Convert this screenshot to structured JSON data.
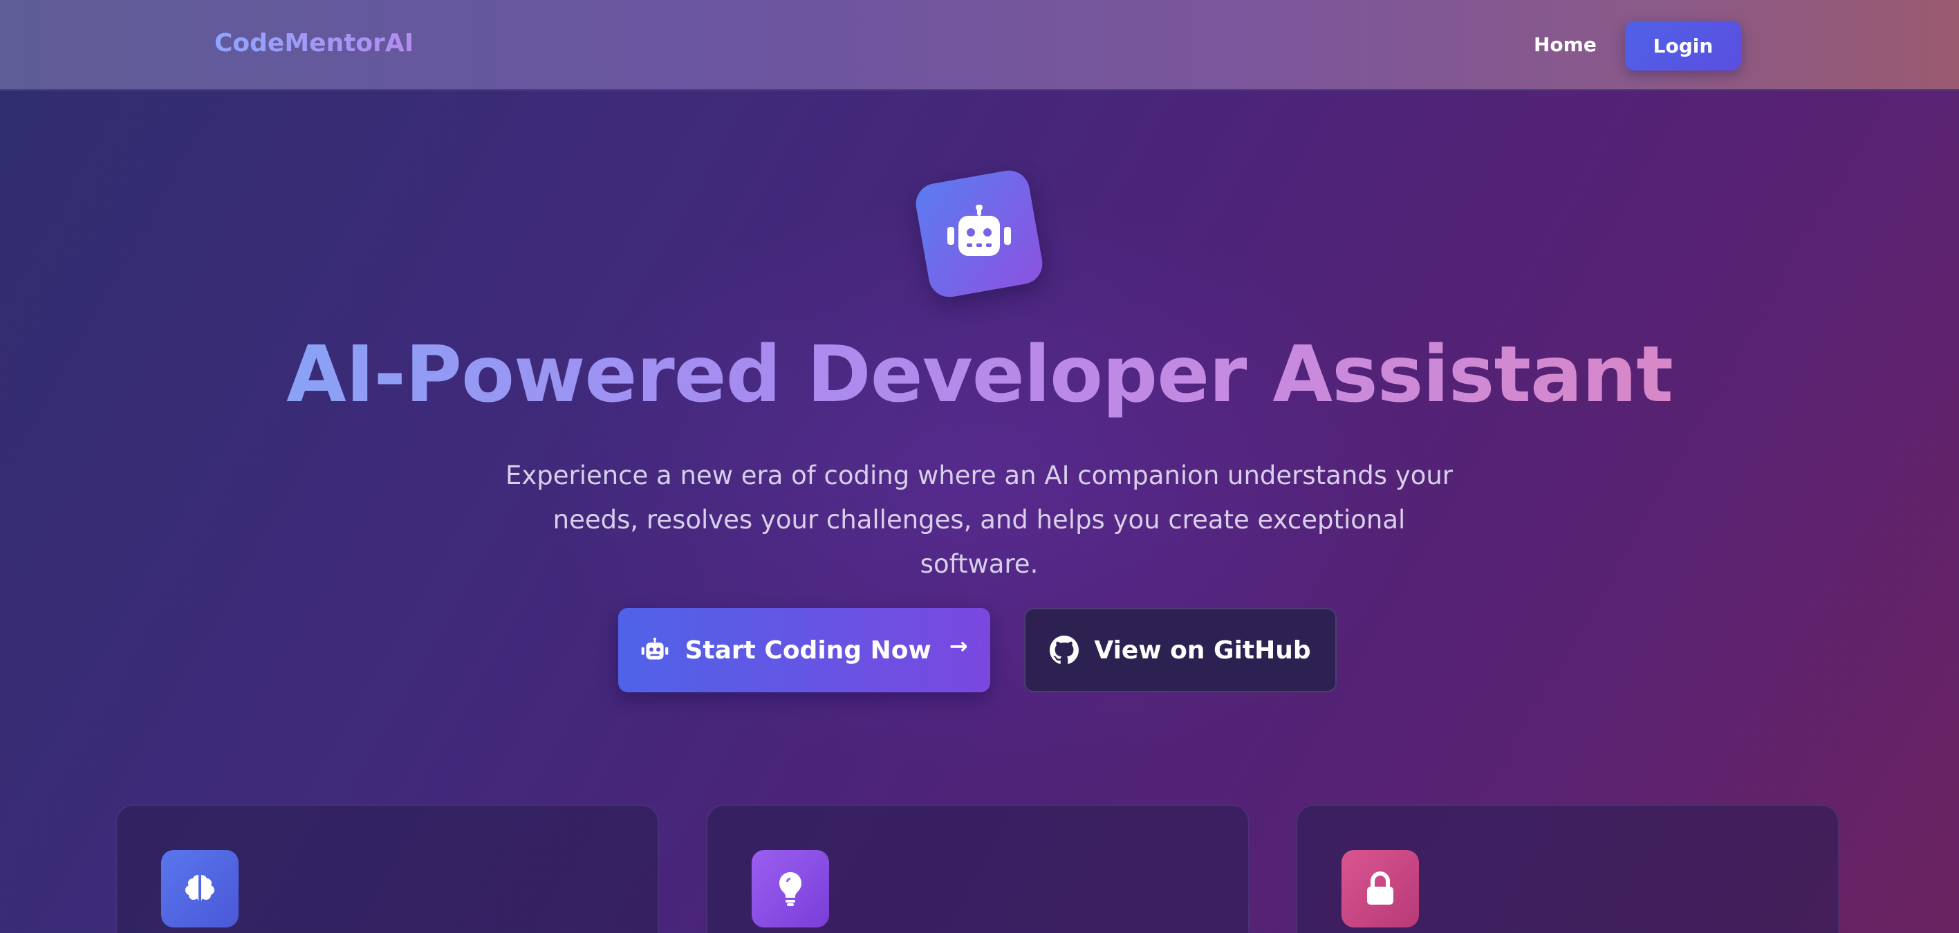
{
  "header": {
    "brand": "CodeMentorAI",
    "nav_home": "Home",
    "login_label": "Login"
  },
  "hero": {
    "icon": "robot-icon",
    "title": "AI-Powered Developer Assistant",
    "subtitle_line1": "Experience a new era of coding where an AI companion understands your",
    "subtitle_line2": "needs, resolves your challenges, and helps you create exceptional software.",
    "primary_cta": "Start Coding Now",
    "primary_cta_arrow": "→",
    "secondary_cta": "View on GitHub"
  },
  "features": [
    {
      "icon": "brain-icon",
      "color": "#5a76ec"
    },
    {
      "icon": "lightbulb-icon",
      "color": "#9a5ff0"
    },
    {
      "icon": "lock-icon",
      "color": "#d9558f"
    }
  ]
}
